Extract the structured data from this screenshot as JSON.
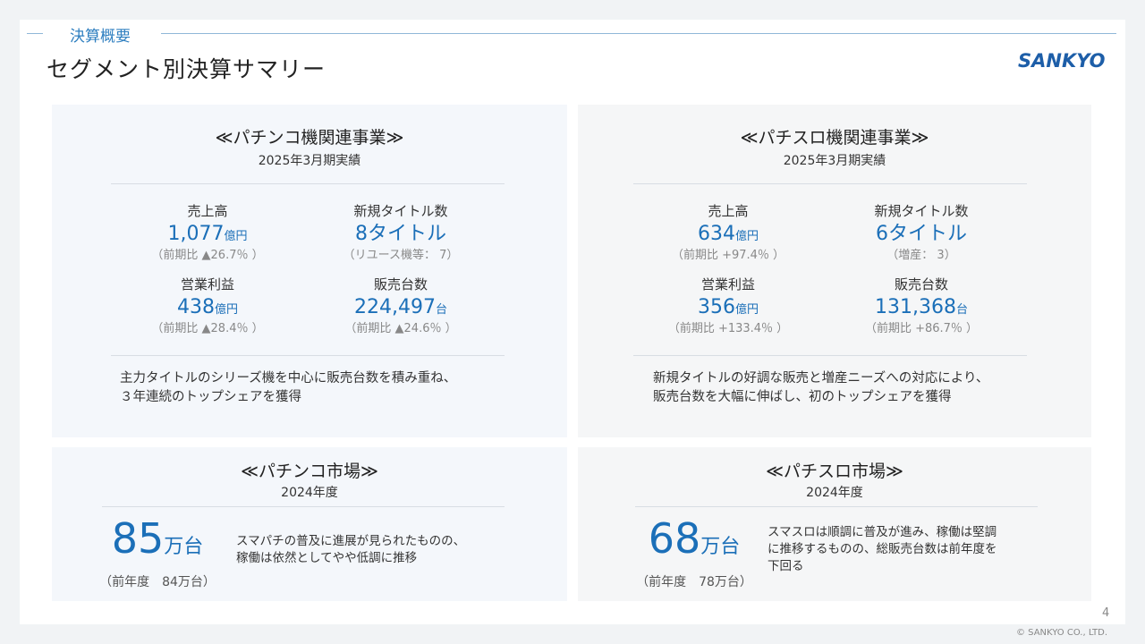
{
  "header": {
    "section": "決算概要",
    "title": "セグメント別決算サマリー",
    "logo": "SANKYO"
  },
  "pachinko_business": {
    "title": "≪パチンコ機関連事業≫",
    "period": "2025年3月期実績",
    "sales": {
      "label": "売上高",
      "value": "1,077",
      "unit": "億円",
      "note": "（前期比 ▲26.7％ ）"
    },
    "titles": {
      "label": "新規タイトル数",
      "value": "8タイトル",
      "note": "（リユース機等： 7）"
    },
    "profit": {
      "label": "営業利益",
      "value": "438",
      "unit": "億円",
      "note": "（前期比 ▲28.4％ ）"
    },
    "units": {
      "label": "販売台数",
      "value": "224,497",
      "unit": "台",
      "note": "（前期比 ▲24.6％ ）"
    },
    "desc_line1": "主力タイトルのシリーズ機を中心に販売台数を積み重ね、",
    "desc_line2": "３年連続のトップシェアを獲得"
  },
  "pachislot_business": {
    "title": "≪パチスロ機関連事業≫",
    "period": "2025年3月期実績",
    "sales": {
      "label": "売上高",
      "value": "634",
      "unit": "億円",
      "note": "（前期比 +97.4％ ）"
    },
    "titles": {
      "label": "新規タイトル数",
      "value": "6タイトル",
      "note": "（増産： 3）"
    },
    "profit": {
      "label": "営業利益",
      "value": "356",
      "unit": "億円",
      "note": "（前期比 +133.4％ ）"
    },
    "units": {
      "label": "販売台数",
      "value": "131,368",
      "unit": "台",
      "note": "（前期比 +86.7％ ）"
    },
    "desc_line1": "新規タイトルの好調な販売と増産ニーズへの対応により、",
    "desc_line2": "販売台数を大幅に伸ばし、初のトップシェアを獲得"
  },
  "pachinko_market": {
    "title": "≪パチンコ市場≫",
    "period": "2024年度",
    "value": "85",
    "unit": "万台",
    "prev": "（前年度　84万台）",
    "desc_line1": "スマパチの普及に進展が見られたものの、",
    "desc_line2": "稼働は依然としてやや低調に推移"
  },
  "pachislot_market": {
    "title": "≪パチスロ市場≫",
    "period": "2024年度",
    "value": "68",
    "unit": "万台",
    "prev": "（前年度　78万台）",
    "desc_line1": "スマスロは順調に普及が進み、稼働は堅調",
    "desc_line2": "に推移するものの、総販売台数は前年度を",
    "desc_line3": "下回る"
  },
  "footer": {
    "page": "4",
    "copyright": "© SANKYO CO., LTD."
  },
  "colors": {
    "accent": "#1b6fb8",
    "panel_blue": "#f4f7fb",
    "panel_gray": "#f5f6f7"
  }
}
